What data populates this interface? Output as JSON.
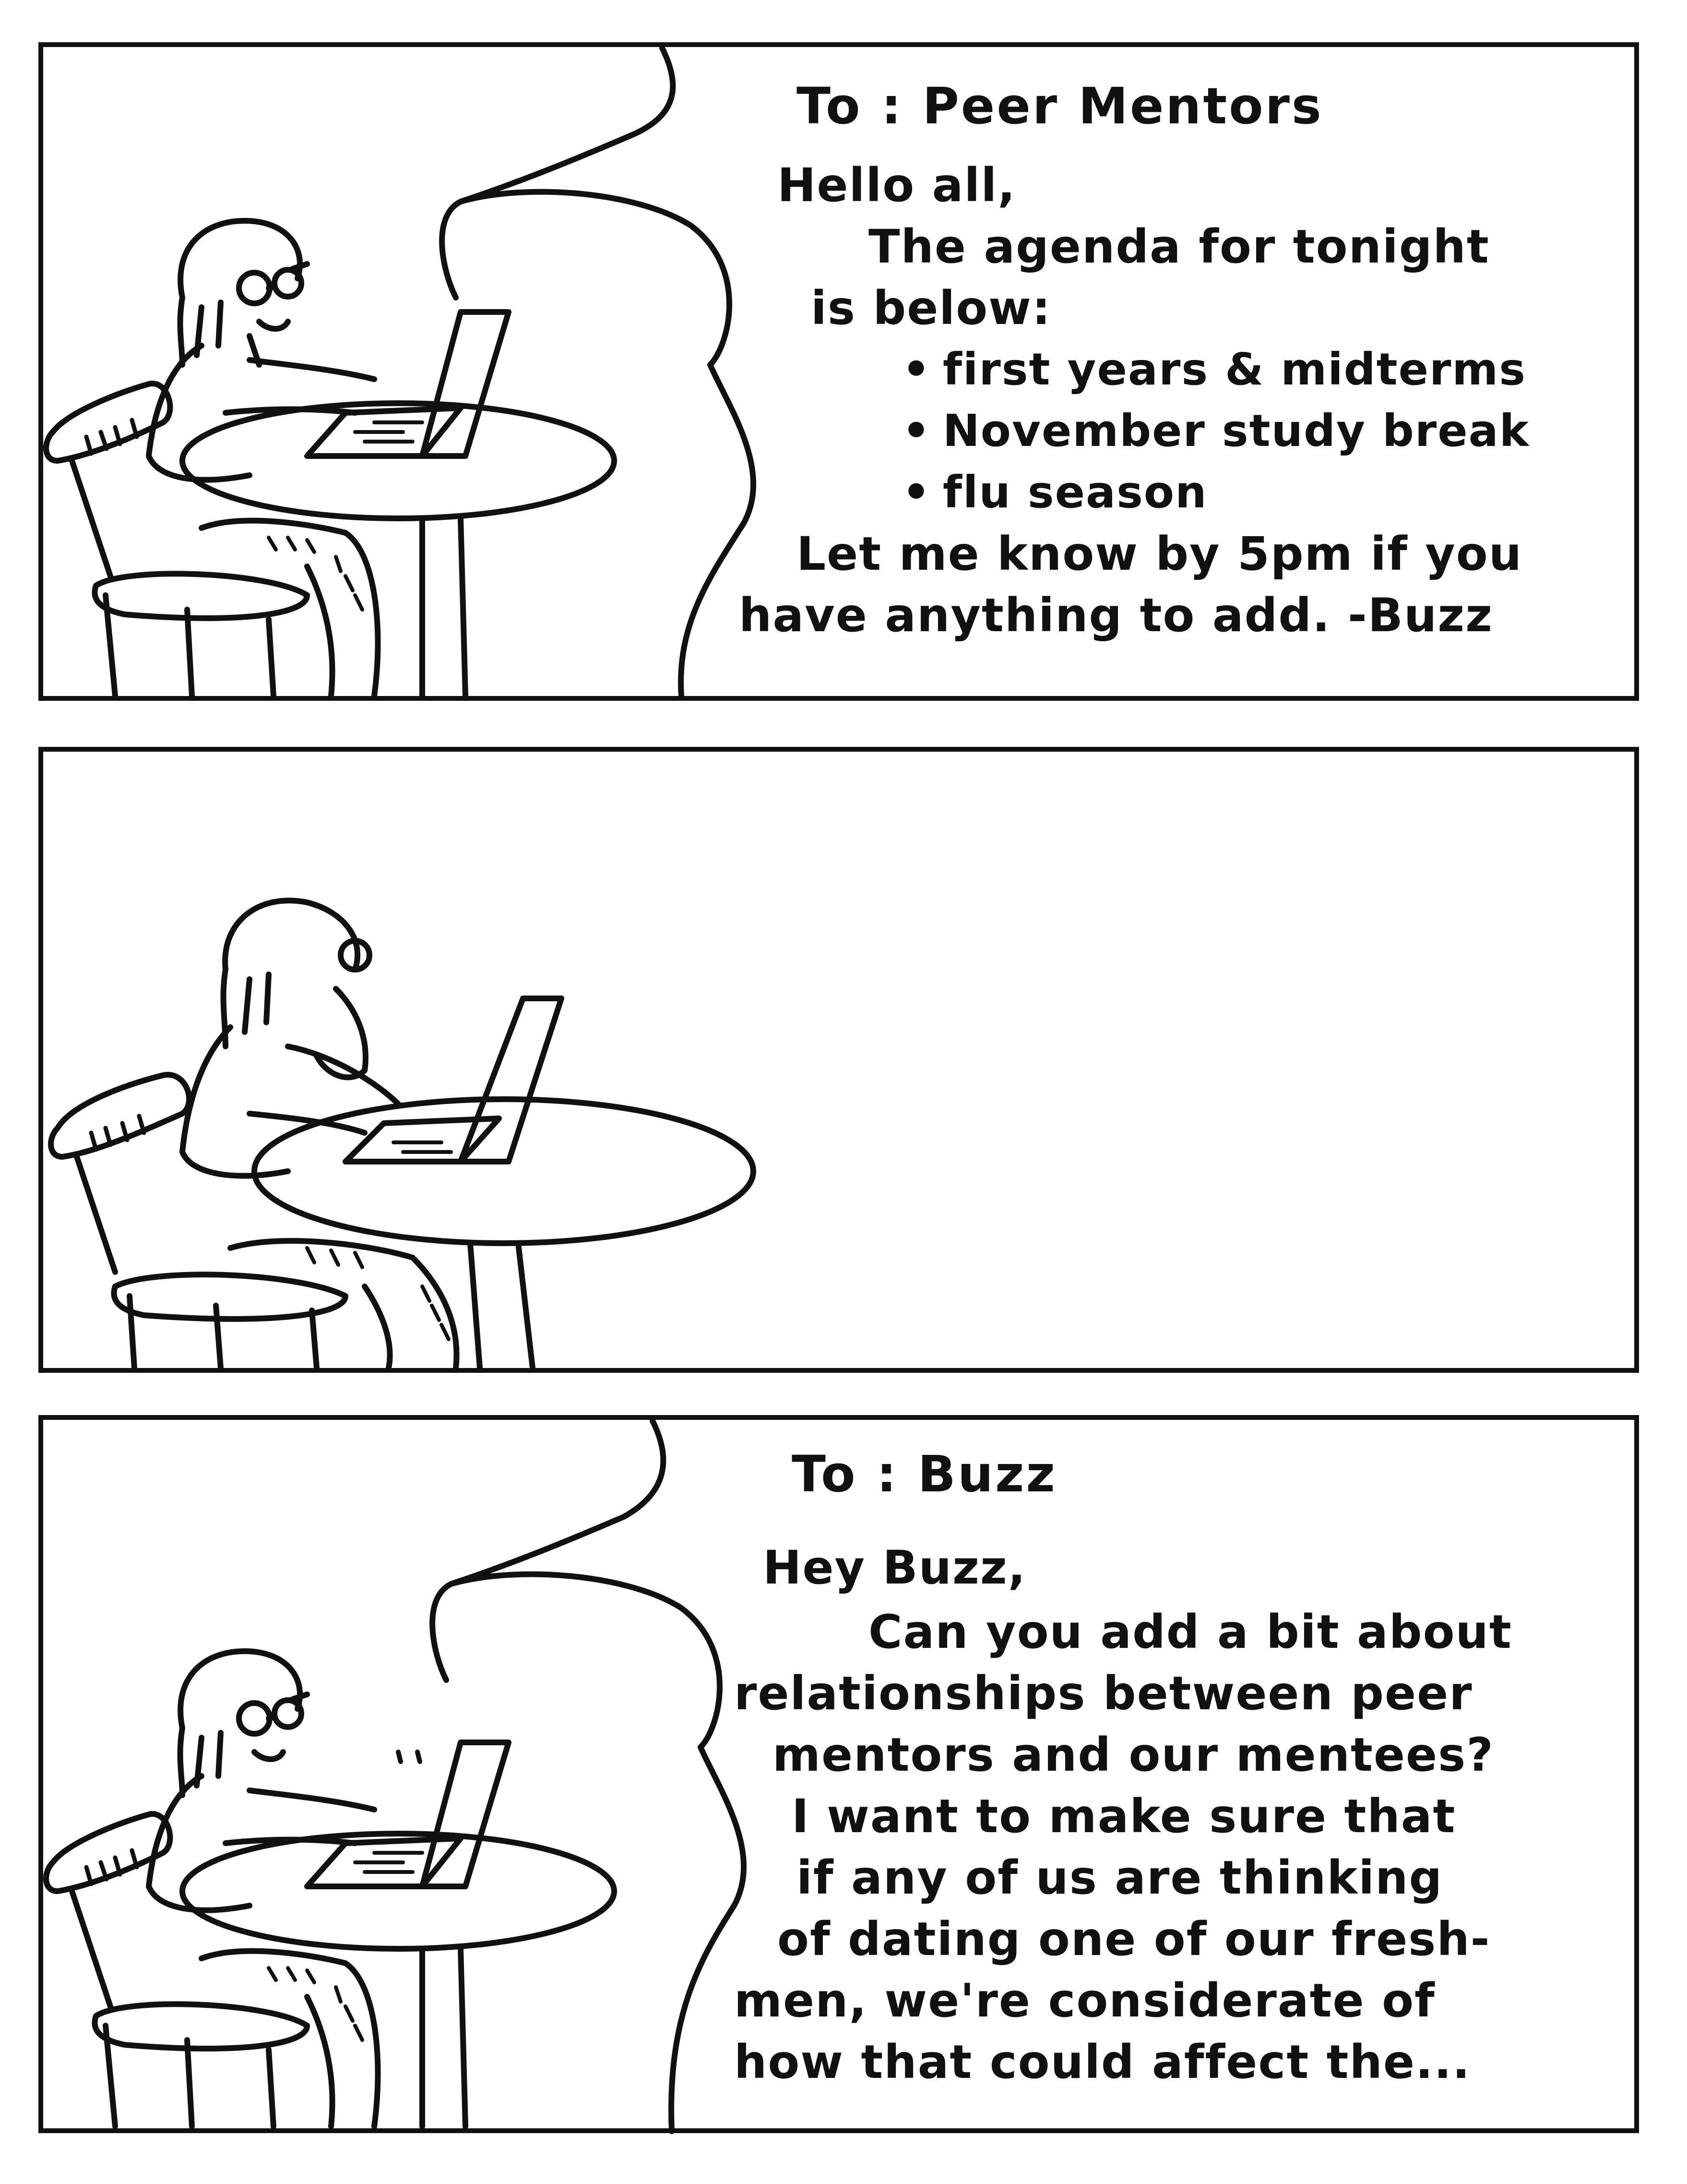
{
  "panel1": {
    "to_line": "To : Peer Mentors",
    "greeting": "Hello all,",
    "intro_line1": "The agenda for tonight",
    "intro_line2": "is below:",
    "bullets": [
      "first years & midterms",
      "November study break",
      "flu season"
    ],
    "closing_line1": "Let me know by 5pm if you",
    "closing_line2": "have anything to add. -Buzz"
  },
  "panel3": {
    "to_line": "To : Buzz",
    "greeting": "Hey Buzz,",
    "lines": [
      "Can you add a bit about",
      "relationships between peer",
      "mentors and our mentees?",
      "I want to make sure that",
      "if any of us are thinking",
      "of dating one of our fresh-",
      "men, we're considerate of",
      "how that could affect the..."
    ]
  }
}
